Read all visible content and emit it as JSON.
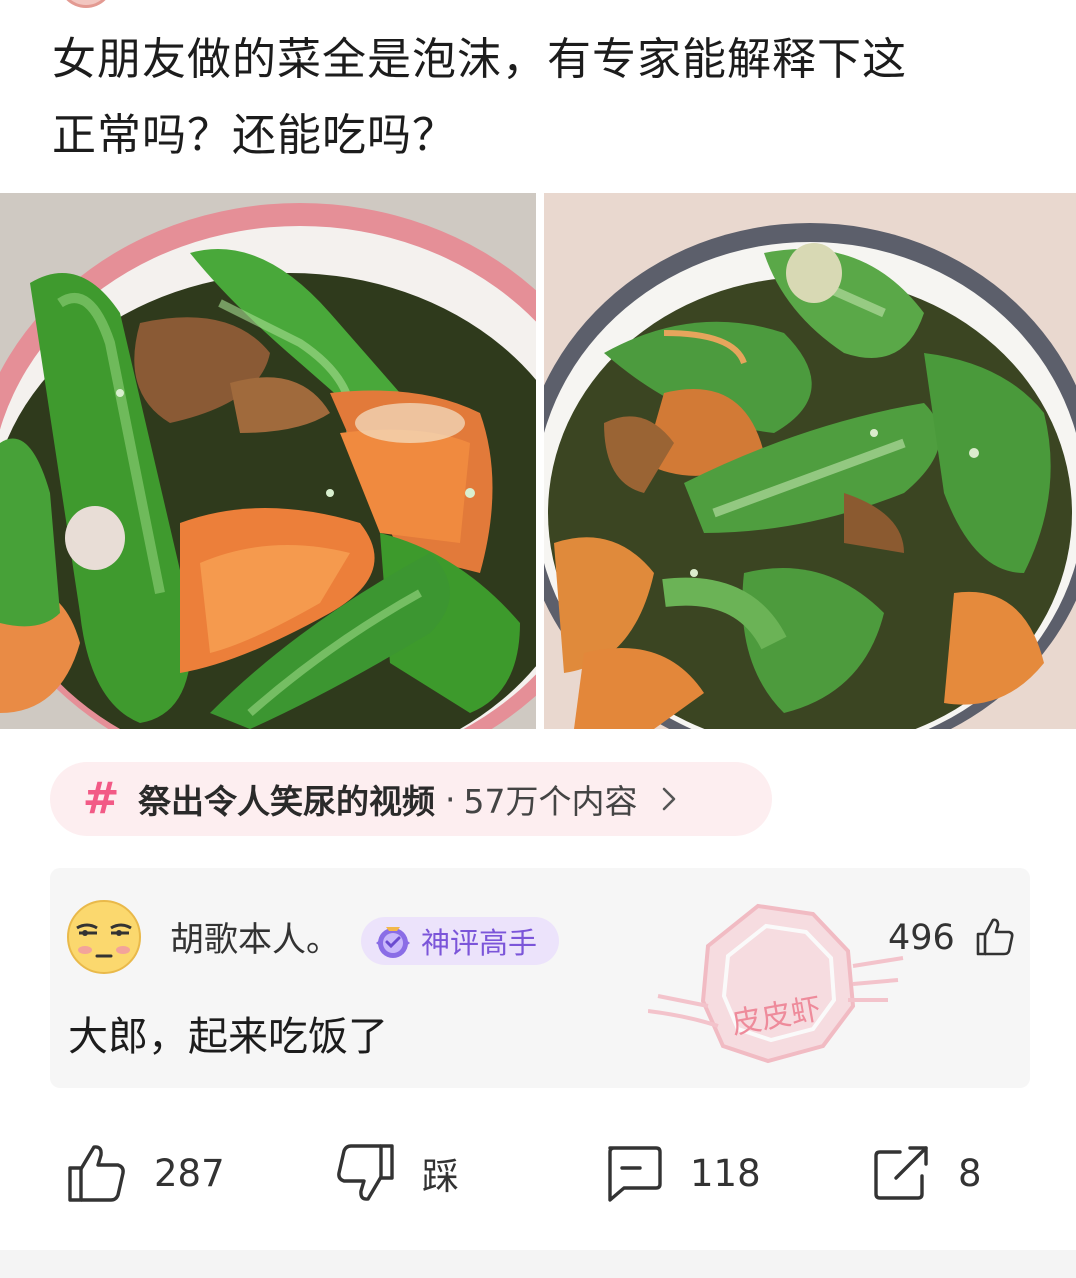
{
  "post": {
    "title_line1": "女朋友做的菜全是泡沫，有专家能解释下这",
    "title_line2": "正常吗？还能吃吗？"
  },
  "topic": {
    "hash": "#",
    "name": "祭出令人笑尿的视频",
    "separator": "·",
    "count": "57万个内容"
  },
  "comment": {
    "username": "胡歌本人。",
    "badge": "神评高手",
    "likes": "496",
    "text": "大郎，起来吃饭了"
  },
  "watermark": {
    "label": "皮皮虾"
  },
  "actions": {
    "like_count": "287",
    "dislike_label": "踩",
    "comment_count": "118",
    "share_count": "8"
  },
  "icons": [
    "thumbs-up-icon",
    "thumbs-down-icon",
    "comment-icon",
    "share-icon",
    "chevron-right-icon",
    "badge-icon"
  ],
  "colors": {
    "accent_pink": "#f25a86",
    "topic_bg": "#fdeef0",
    "badge_bg": "#ece3fb",
    "badge_text": "#7b55d9",
    "card_bg": "#f6f6f6"
  }
}
